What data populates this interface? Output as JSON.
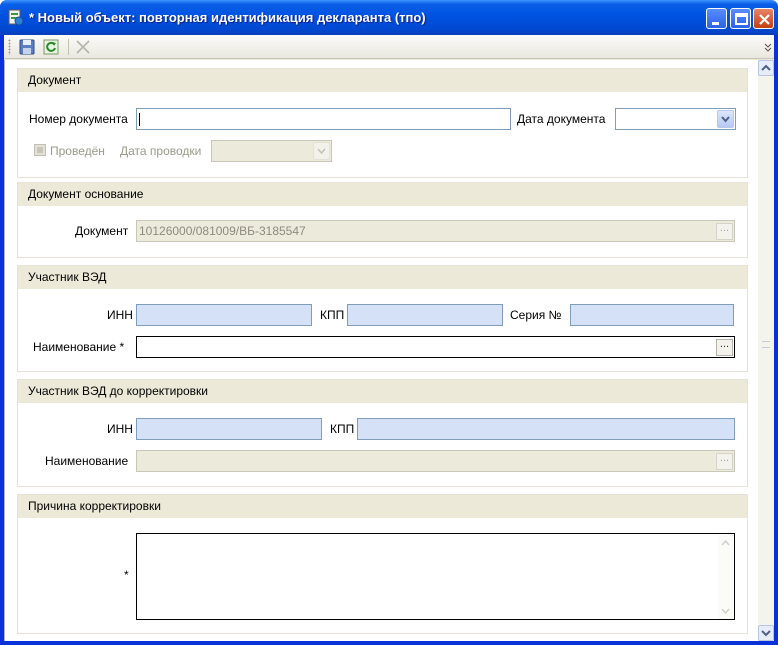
{
  "window": {
    "title": "* Новый объект: повторная идентификация декларанта (тпо)",
    "icon": "app-document-icon",
    "controls": [
      "minimize-icon",
      "maximize-icon",
      "close-icon"
    ]
  },
  "toolbar": {
    "buttons": [
      {
        "icon": "save-icon"
      },
      {
        "icon": "refresh-icon"
      },
      {
        "icon": "cancel-icon"
      }
    ]
  },
  "sections": {
    "document": {
      "header": "Документ",
      "number_label": "Номер документа",
      "number_value": "",
      "date_label": "Дата документа",
      "date_value": "",
      "posted_label": "Проведён",
      "posted_checked": false,
      "posting_date_label": "Дата проводки",
      "posting_date_value": ""
    },
    "basis": {
      "header": "Документ основание",
      "doc_label": "Документ",
      "doc_value": "10126000/081009/ВБ-3185547"
    },
    "participant": {
      "header": "Участник ВЭД",
      "inn_label": "ИНН",
      "inn_value": "",
      "kpp_label": "КПП",
      "kpp_value": "",
      "series_label": "Серия №",
      "series_value": "",
      "name_label": "Наименование *",
      "name_value": ""
    },
    "participant_before": {
      "header": "Участник ВЭД до корректировки",
      "inn_label": "ИНН",
      "inn_value": "",
      "kpp_label": "КПП",
      "kpp_value": "",
      "name_label": "Наименование",
      "name_value": ""
    },
    "reason": {
      "header": "Причина корректировки",
      "required_mark": "*",
      "value": ""
    }
  },
  "colors": {
    "title_bar": "#0054e3",
    "panel_header": "#ece9d8",
    "input_highlight": "#d5e1f7",
    "input_border": "#7f9db9"
  }
}
